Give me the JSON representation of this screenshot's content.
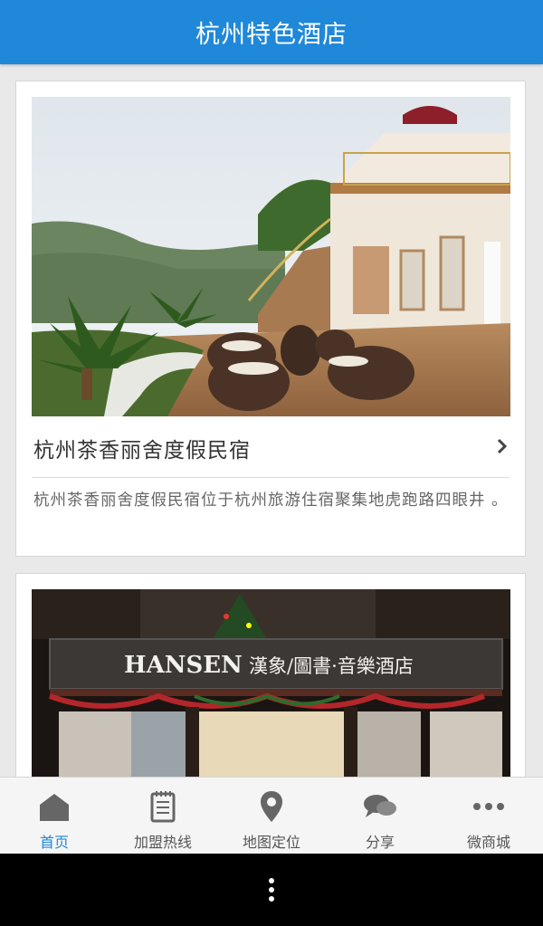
{
  "header": {
    "title": "杭州特色酒店"
  },
  "cards": [
    {
      "title": "杭州茶香丽舍度假民宿",
      "description": "杭州茶香丽舍度假民宿位于杭州旅游住宿聚集地虎跑路四眼井 。",
      "image_icon": "hotel-terrace-photo"
    },
    {
      "sign_latin": "HANSEN",
      "sign_cn": "漢象/圖書·音樂酒店",
      "image_icon": "hotel-storefront-photo"
    }
  ],
  "tabs": [
    {
      "label": "首页",
      "icon": "home-icon",
      "active": true
    },
    {
      "label": "加盟热线",
      "icon": "notepad-icon",
      "active": false
    },
    {
      "label": "地图定位",
      "icon": "map-pin-icon",
      "active": false
    },
    {
      "label": "分享",
      "icon": "chat-bubbles-icon",
      "active": false
    },
    {
      "label": "微商城",
      "icon": "more-dots-icon",
      "active": false
    }
  ],
  "colors": {
    "accent": "#1f88d9",
    "tab_icon": "#666666",
    "background": "#e9e9e9"
  }
}
